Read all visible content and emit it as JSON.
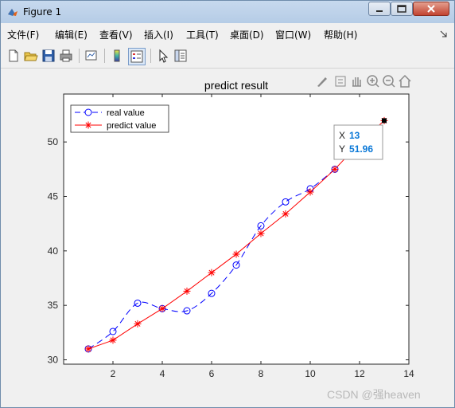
{
  "window": {
    "title": "Figure 1"
  },
  "menu": [
    "文件(F)",
    "编辑(E)",
    "查看(V)",
    "插入(I)",
    "工具(T)",
    "桌面(D)",
    "窗口(W)",
    "帮助(H)"
  ],
  "toolbar": {
    "icons": [
      "new-figure-icon",
      "open-file-icon",
      "save-icon",
      "print-icon",
      "link-plot-icon",
      "insert-colorbar-icon",
      "insert-legend-icon",
      "pointer-icon",
      "property-editor-icon"
    ]
  },
  "axes_toolbar": {
    "icons": [
      "brush-icon",
      "data-tip-icon",
      "pan-icon",
      "zoom-in-icon",
      "zoom-out-icon",
      "home-icon"
    ]
  },
  "chart_data": {
    "type": "line",
    "title": "predict result",
    "xlabel": "",
    "ylabel": "",
    "xlim": [
      0,
      14
    ],
    "ylim": [
      29.6,
      54.4
    ],
    "xticks": [
      2,
      4,
      6,
      8,
      10,
      12,
      14
    ],
    "yticks": [
      30,
      35,
      40,
      45,
      50
    ],
    "grid": false,
    "legend_position": "top-left",
    "series": [
      {
        "name": "real value",
        "style": "dashed-circle",
        "color": "#0000ff",
        "x": [
          1,
          2,
          3,
          4,
          5,
          6,
          7,
          8,
          9,
          10,
          11
        ],
        "y": [
          31.0,
          32.6,
          35.2,
          34.7,
          34.5,
          36.1,
          38.7,
          42.3,
          44.5,
          45.7,
          47.5
        ]
      },
      {
        "name": "predict value",
        "style": "solid-star",
        "color": "#ff0000",
        "x": [
          1,
          2,
          3,
          4,
          5,
          6,
          7,
          8,
          9,
          10,
          11,
          12,
          13
        ],
        "y": [
          31.0,
          31.8,
          33.3,
          34.7,
          36.3,
          38.0,
          39.7,
          41.6,
          43.4,
          45.4,
          47.5,
          49.9,
          51.96
        ]
      }
    ],
    "datatip": {
      "x_label": "X",
      "x_value": "13",
      "y_label": "Y",
      "y_value": "51.96"
    }
  },
  "watermark": "CSDN @强heaven"
}
